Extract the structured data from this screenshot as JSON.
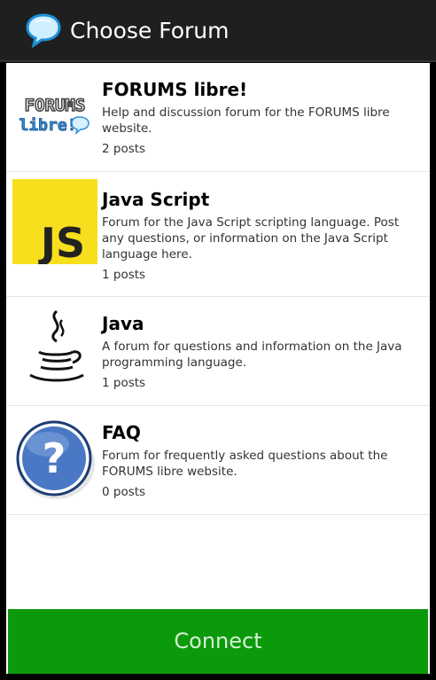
{
  "header": {
    "title": "Choose Forum",
    "icon": "speech-bubble-icon"
  },
  "forums": [
    {
      "name": "FORUMS libre!",
      "description": "Help and discussion forum for the FORUMS libre website.",
      "posts": "2 posts",
      "icon": "forums-libre-logo",
      "logo_text_top": "FORUMS",
      "logo_text_bottom": "libre!"
    },
    {
      "name": "Java Script",
      "description": "Forum for the Java Script scripting language.  Post any questions, or information on the Java Script language here.",
      "posts": "1 posts",
      "icon": "javascript-logo",
      "logo_text": "JS"
    },
    {
      "name": "Java",
      "description": "A forum for questions and information on the Java programming language.",
      "posts": "1 posts",
      "icon": "java-coffee-cup-logo"
    },
    {
      "name": "FAQ",
      "description": "Forum for frequently asked questions about the FORUMS libre website.",
      "posts": "0 posts",
      "icon": "question-mark-icon",
      "logo_text": "?"
    }
  ],
  "footer": {
    "connect_label": "Connect"
  },
  "colors": {
    "action_bar": "#1f1f1f",
    "connect_button": "#0b9a0b",
    "connect_text": "#d6f0d6",
    "js_yellow": "#f7df1e",
    "faq_blue": "#2f5fa8"
  }
}
